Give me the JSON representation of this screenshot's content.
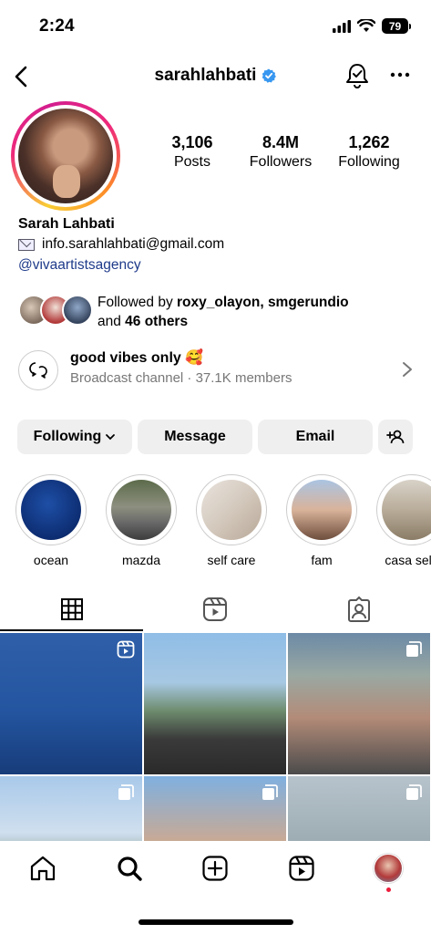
{
  "status_bar": {
    "time": "2:24",
    "battery": "79"
  },
  "header": {
    "username": "sarahlahbati"
  },
  "stats": [
    {
      "value": "3,106",
      "label": "Posts"
    },
    {
      "value": "8.4M",
      "label": "Followers"
    },
    {
      "value": "1,262",
      "label": "Following"
    }
  ],
  "bio": {
    "name": "Sarah Lahbati",
    "email": "info.sarahlahbati@gmail.com",
    "link": "@vivaartistsagency"
  },
  "followed_by": {
    "prefix": "Followed by ",
    "users": "roxy_olayon, smgerundio",
    "and": "and ",
    "others": "46 others"
  },
  "broadcast": {
    "title": "good vibes only 🥰",
    "subtitle": "Broadcast channel · 37.1K members"
  },
  "buttons": {
    "following": "Following",
    "message": "Message",
    "email": "Email"
  },
  "highlights": [
    "ocean",
    "mazda",
    "self care",
    "fam",
    "casa selu"
  ],
  "colors": {
    "link": "#1e3a8a",
    "verified": "#3797f0",
    "button_bg": "#efefef"
  }
}
